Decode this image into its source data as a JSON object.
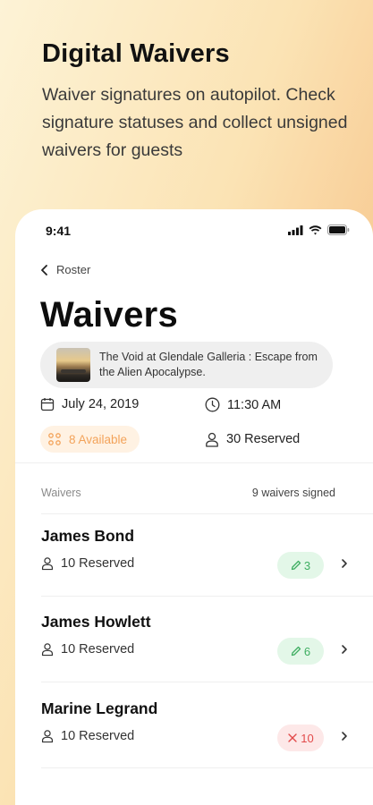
{
  "promo": {
    "title": "Digital Waivers",
    "subtitle": "Waiver signatures on autopilot. Check signature statuses and collect unsigned waivers for guests"
  },
  "status_bar": {
    "time": "9:41"
  },
  "nav": {
    "back_label": "Roster"
  },
  "page": {
    "title": "Waivers"
  },
  "event": {
    "title": "The Void at Glendale Galleria : Escape from the Alien Apocalypse."
  },
  "info": {
    "date": "July 24, 2019",
    "time": "11:30 AM",
    "available": "8 Available",
    "reserved": "30 Reserved"
  },
  "waivers_section": {
    "label": "Waivers",
    "summary": "9 waivers signed"
  },
  "guests": [
    {
      "name": "James Bond",
      "reserved": "10 Reserved",
      "count": "3",
      "status": "signed"
    },
    {
      "name": "James Howlett",
      "reserved": "10 Reserved",
      "count": "6",
      "status": "signed"
    },
    {
      "name": "Marine Legrand",
      "reserved": "10 Reserved",
      "count": "10",
      "status": "unsigned"
    }
  ],
  "colors": {
    "accent_orange": "#f3a35a",
    "signed_green": "#3fae62",
    "unsigned_red": "#e24a4a"
  },
  "icons": {
    "back": "chevron-left-icon",
    "calendar": "calendar-icon",
    "clock": "clock-icon",
    "available": "grid-dots-icon",
    "person": "person-icon",
    "signed": "pencil-icon",
    "unsigned": "x-icon",
    "row_chevron": "chevron-right-icon"
  }
}
